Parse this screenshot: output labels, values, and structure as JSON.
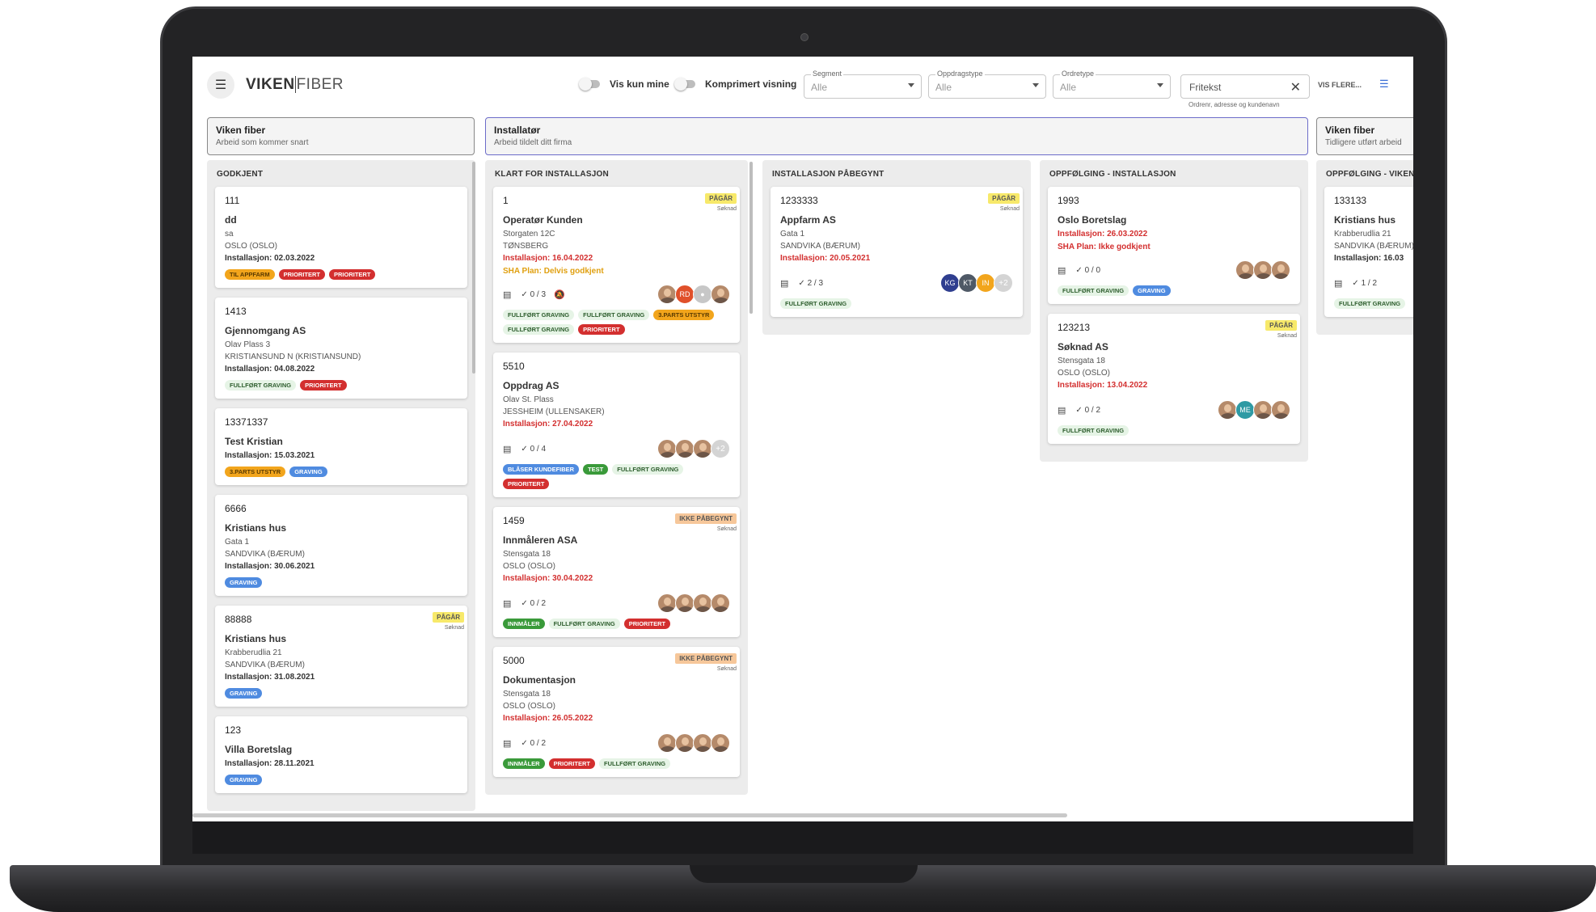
{
  "brand": {
    "bold": "VIKEN",
    "thin": "FIBER"
  },
  "toggles": {
    "mine": "Vis kun mine",
    "compact": "Komprimert visning"
  },
  "filters": [
    {
      "label": "Segment",
      "value": "Alle"
    },
    {
      "label": "Oppdragstype",
      "value": "Alle"
    },
    {
      "label": "Ordretype",
      "value": "Alle"
    }
  ],
  "search": {
    "value": "Fritekst",
    "help": "Ordrenr, adresse og kundenavn"
  },
  "more_label": "VIS FLERE...",
  "groups": [
    {
      "title": "Viken fiber",
      "subtitle": "Arbeid som kommer snart"
    },
    {
      "title": "Installatør",
      "subtitle": "Arbeid tildelt ditt firma"
    },
    {
      "title": "Viken fiber",
      "subtitle": "Tidligere utført arbeid"
    }
  ],
  "colors": {
    "red": "#d32f2f",
    "pagar": "#f7e96a",
    "ikke": "#f6c79a",
    "green": "#e6f4e6",
    "blue": "#4f8be0",
    "orange": "#f2a51c"
  },
  "columns": [
    {
      "title": "GODKJENT",
      "cards": [
        {
          "num": "111",
          "name": "dd",
          "lines": [
            "sa",
            "OSLO  (OSLO)"
          ],
          "inst": "Installasjon: 02.03.2022",
          "inst_red": false,
          "tags": [
            {
              "t": "TIL APPFARM",
              "c": "orange"
            },
            {
              "t": "PRIORITERT",
              "c": "red"
            },
            {
              "t": "PRIORITERT",
              "c": "red"
            }
          ]
        },
        {
          "num": "1413",
          "name": "Gjennomgang AS",
          "lines": [
            "Olav Plass 3",
            "KRISTIANSUND N  (KRISTIANSUND)"
          ],
          "inst": "Installasjon: 04.08.2022",
          "inst_red": false,
          "tags": [
            {
              "t": "FULLFØRT GRAVING",
              "c": "green"
            },
            {
              "t": "PRIORITERT",
              "c": "red"
            }
          ]
        },
        {
          "num": "13371337",
          "name": "Test Kristian",
          "lines": [],
          "inst": "Installasjon: 15.03.2021",
          "inst_red": false,
          "tags": [
            {
              "t": "3.PARTS UTSTYR",
              "c": "orange"
            },
            {
              "t": "GRAVING",
              "c": "blue"
            }
          ]
        },
        {
          "num": "6666",
          "name": "Kristians hus",
          "lines": [
            "Gata 1",
            "SANDVIKA  (BÆRUM)"
          ],
          "inst": "Installasjon: 30.06.2021",
          "inst_red": false,
          "tags": [
            {
              "t": "GRAVING",
              "c": "blue"
            }
          ]
        },
        {
          "num": "88888",
          "name": "Kristians hus",
          "lines": [
            "Krabberudlia 21",
            "SANDVIKA  (BÆRUM)"
          ],
          "inst": "Installasjon: 31.08.2021",
          "inst_red": false,
          "badge": {
            "t": "PÅGÅR",
            "c": "pagar",
            "s": "Søknad"
          },
          "tags": [
            {
              "t": "GRAVING",
              "c": "blue"
            }
          ]
        },
        {
          "num": "123",
          "name": "Villa Boretslag",
          "lines": [],
          "inst": "Installasjon: 28.11.2021",
          "inst_red": false,
          "tags": [
            {
              "t": "GRAVING",
              "c": "blue"
            }
          ]
        }
      ]
    },
    {
      "title": "KLART FOR INSTALLASJON",
      "cards": [
        {
          "num": "1",
          "name": "Operatør Kunden",
          "lines": [
            "Storgaten 12C",
            "TØNSBERG"
          ],
          "inst": "Installasjon: 16.04.2022",
          "inst_red": true,
          "sha": "SHA Plan: Delvis godkjent",
          "sha_color": "#e0a010",
          "badge": {
            "t": "PÅGÅR",
            "c": "pagar",
            "s": "Søknad"
          },
          "meta": {
            "count": "0 / 3",
            "bell": true,
            "avatars": [
              "photo",
              "RD",
              "ghost",
              "photo"
            ]
          },
          "tags": [
            {
              "t": "FULLFØRT GRAVING",
              "c": "green"
            },
            {
              "t": "FULLFØRT GRAVING",
              "c": "green"
            },
            {
              "t": "3.PARTS UTSTYR",
              "c": "orange"
            },
            {
              "t": "FULLFØRT GRAVING",
              "c": "green"
            },
            {
              "t": "PRIORITERT",
              "c": "red"
            }
          ]
        },
        {
          "num": "5510",
          "name": "Oppdrag AS",
          "lines": [
            "Olav St. Plass",
            "JESSHEIM  (ULLENSAKER)"
          ],
          "inst": "Installasjon: 27.04.2022",
          "inst_red": true,
          "meta": {
            "count": "0 / 4",
            "avatars": [
              "photo",
              "photo",
              "photo",
              "+2"
            ]
          },
          "tags": [
            {
              "t": "BLÅSER KUNDEFIBER",
              "c": "blue"
            },
            {
              "t": "TEST",
              "c": "dgreen"
            },
            {
              "t": "FULLFØRT GRAVING",
              "c": "green"
            },
            {
              "t": "PRIORITERT",
              "c": "red"
            }
          ]
        },
        {
          "num": "1459",
          "name": "Innmåleren ASA",
          "lines": [
            "Stensgata 18",
            "OSLO  (OSLO)"
          ],
          "inst": "Installasjon: 30.04.2022",
          "inst_red": true,
          "badge": {
            "t": "IKKE PÅBEGYNT",
            "c": "ikke",
            "s": "Søknad"
          },
          "meta": {
            "count": "0 / 2",
            "avatars": [
              "photo",
              "photo",
              "photo",
              "photo"
            ]
          },
          "tags": [
            {
              "t": "INNMÅLER",
              "c": "dgreen"
            },
            {
              "t": "FULLFØRT GRAVING",
              "c": "green"
            },
            {
              "t": "PRIORITERT",
              "c": "red"
            }
          ]
        },
        {
          "num": "5000",
          "name": "Dokumentasjon",
          "lines": [
            "Stensgata 18",
            "OSLO  (OSLO)"
          ],
          "inst": "Installasjon: 26.05.2022",
          "inst_red": true,
          "badge": {
            "t": "IKKE PÅBEGYNT",
            "c": "ikke",
            "s": "Søknad"
          },
          "meta": {
            "count": "0 / 2",
            "avatars": [
              "photo",
              "photo",
              "photo",
              "photo"
            ]
          },
          "tags": [
            {
              "t": "INNMÅLER",
              "c": "dgreen"
            },
            {
              "t": "PRIORITERT",
              "c": "red"
            },
            {
              "t": "FULLFØRT GRAVING",
              "c": "green"
            }
          ]
        }
      ]
    },
    {
      "title": "INSTALLASJON PÅBEGYNT",
      "cards": [
        {
          "num": "1233333",
          "name": "Appfarm AS",
          "lines": [
            "Gata 1",
            "SANDVIKA  (BÆRUM)"
          ],
          "inst": "Installasjon: 20.05.2021",
          "inst_red": true,
          "badge": {
            "t": "PÅGÅR",
            "c": "pagar",
            "s": "Søknad"
          },
          "meta": {
            "count": "2 / 3",
            "avatars": [
              "KG",
              "KT",
              "IN",
              "+2"
            ]
          },
          "tags": [
            {
              "t": "FULLFØRT GRAVING",
              "c": "green"
            }
          ]
        }
      ]
    },
    {
      "title": "OPPFØLGING - INSTALLASJON",
      "cards": [
        {
          "num": "1993",
          "name": "Oslo Boretslag",
          "lines": [],
          "inst": "Installasjon: 26.03.2022",
          "inst_red": true,
          "sha": "SHA Plan: Ikke godkjent",
          "sha_color": "#d32f2f",
          "meta": {
            "count": "0 / 0",
            "avatars": [
              "photo",
              "photo",
              "photo"
            ]
          },
          "tags": [
            {
              "t": "FULLFØRT GRAVING",
              "c": "green"
            },
            {
              "t": "GRAVING",
              "c": "blue"
            }
          ]
        },
        {
          "num": "123213",
          "name": "Søknad AS",
          "lines": [
            "Stensgata 18",
            "OSLO  (OSLO)"
          ],
          "inst": "Installasjon: 13.04.2022",
          "inst_red": true,
          "badge": {
            "t": "PÅGÅR",
            "c": "pagar",
            "s": "Søknad"
          },
          "meta": {
            "count": "0 / 2",
            "avatars": [
              "photo",
              "ME",
              "photo",
              "photo"
            ]
          },
          "tags": [
            {
              "t": "FULLFØRT GRAVING",
              "c": "green"
            }
          ]
        }
      ]
    },
    {
      "title": "OPPFØLGING - VIKEN",
      "cards": [
        {
          "num": "133133",
          "name": "Kristians hus",
          "lines": [
            "Krabberudlia 21",
            "SANDVIKA  (BÆRUM)"
          ],
          "inst": "Installasjon: 16.03",
          "inst_red": false,
          "meta": {
            "count": "1 / 2",
            "avatars": []
          },
          "tags": [
            {
              "t": "FULLFØRT GRAVING",
              "c": "green"
            }
          ]
        }
      ]
    }
  ]
}
